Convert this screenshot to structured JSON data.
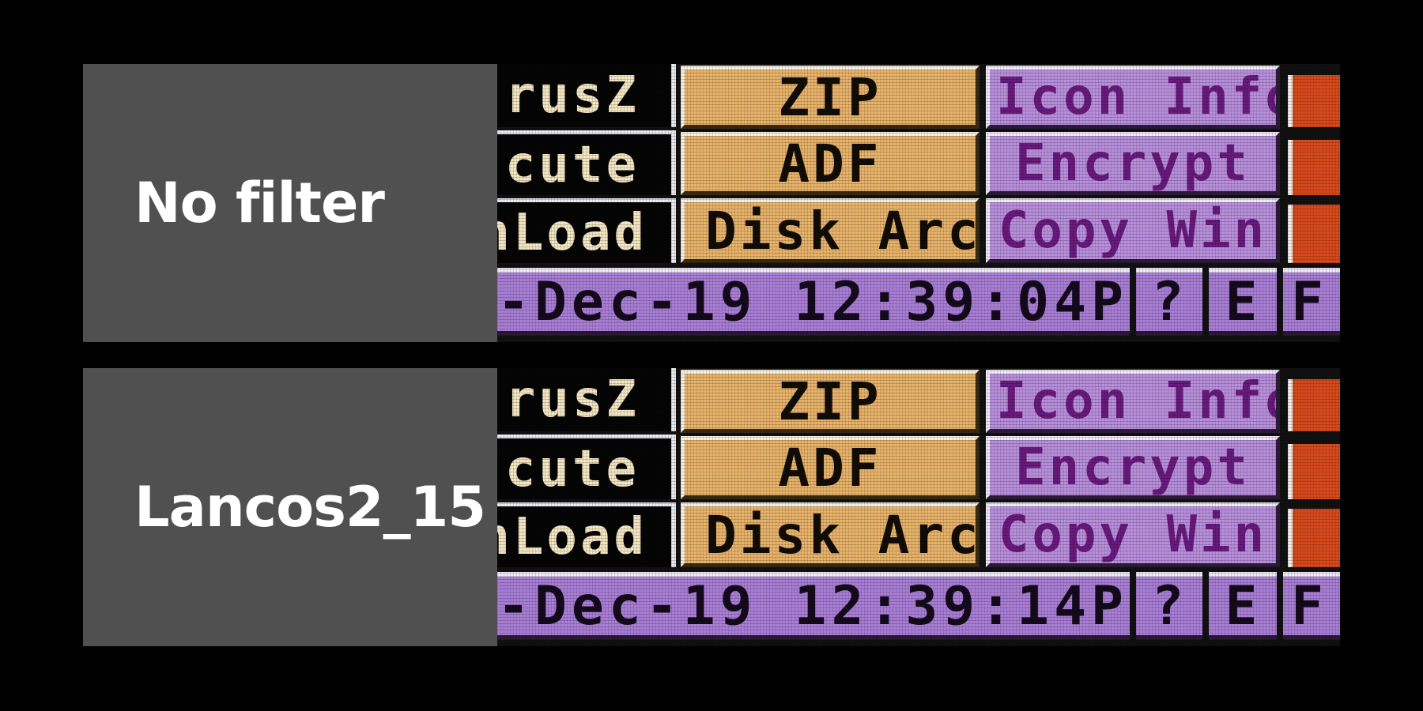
{
  "panels": [
    {
      "label": "No filter",
      "screen": {
        "left_col": [
          "rusZ",
          "cute",
          "nLoad"
        ],
        "orange_buttons": [
          "ZIP",
          "ADF",
          "Disk Arc"
        ],
        "purple_buttons": [
          "Icon Info",
          "Encrypt",
          "Copy Win"
        ],
        "status": {
          "clock": "-Dec-19  12:39:04P",
          "q": "?",
          "e": "E",
          "f": "F"
        }
      }
    },
    {
      "label": "Lancos2_15",
      "screen": {
        "left_col": [
          "rusZ",
          "cute",
          "nLoad"
        ],
        "orange_buttons": [
          "ZIP",
          "ADF",
          "Disk Arc"
        ],
        "purple_buttons": [
          "Icon Info",
          "Encrypt",
          "Copy Win"
        ],
        "status": {
          "clock": "-Dec-19  12:39:14P",
          "q": "?",
          "e": "E",
          "f": "F"
        }
      }
    }
  ],
  "colors": {
    "background": "#000000",
    "label_box": "#505050",
    "orange": "#e8b36a",
    "purple": "#b88fdc",
    "purple_text": "#6a1a7e",
    "red": "#d84a1c"
  }
}
